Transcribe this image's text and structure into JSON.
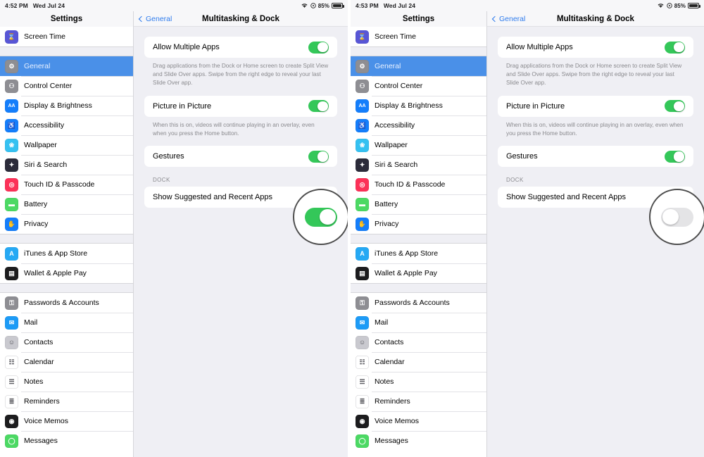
{
  "panels": [
    {
      "id": "left",
      "statusbar": {
        "time": "4:52 PM",
        "date": "Wed Jul 24",
        "battery_pct": "85%"
      },
      "sidebar_title": "Settings",
      "nav": {
        "back_label": "General",
        "title": "Multitasking & Dock"
      },
      "rows": [
        {
          "label": "Allow Multiple Apps",
          "state": "on"
        },
        {
          "label": "Picture in Picture",
          "state": "on"
        },
        {
          "label": "Gestures",
          "state": "on"
        },
        {
          "label": "Show Suggested and Recent Apps",
          "state": "on"
        }
      ],
      "hint_multiple": "Drag applications from the Dock or Home screen to create Split View and Slide Over apps. Swipe from the right edge to reveal your last Slide Over app.",
      "hint_pip": "When this is on, videos will continue playing in an overlay, even when you press the Home button.",
      "dock_header": "DOCK",
      "annotated_toggle_state": "on"
    },
    {
      "id": "right",
      "statusbar": {
        "time": "4:53 PM",
        "date": "Wed Jul 24",
        "battery_pct": "85%"
      },
      "sidebar_title": "Settings",
      "nav": {
        "back_label": "General",
        "title": "Multitasking & Dock"
      },
      "rows": [
        {
          "label": "Allow Multiple Apps",
          "state": "on"
        },
        {
          "label": "Picture in Picture",
          "state": "on"
        },
        {
          "label": "Gestures",
          "state": "on"
        },
        {
          "label": "Show Suggested and Recent Apps",
          "state": "off"
        }
      ],
      "hint_multiple": "Drag applications from the Dock or Home screen to create Split View and Slide Over apps. Swipe from the right edge to reveal your last Slide Over app.",
      "hint_pip": "When this is on, videos will continue playing in an overlay, even when you press the Home button.",
      "dock_header": "DOCK",
      "annotated_toggle_state": "off"
    }
  ],
  "sidebar_groups": [
    {
      "items": [
        {
          "label": "Screen Time",
          "icon": "hourglass-icon",
          "color": "#5856d6",
          "glyph": "⌛",
          "selected": false
        }
      ]
    },
    {
      "items": [
        {
          "label": "General",
          "icon": "gear-icon",
          "color": "#8e8e93",
          "glyph": "⚙",
          "selected": true
        },
        {
          "label": "Control Center",
          "icon": "control-center-icon",
          "color": "#8e8e93",
          "glyph": "⚇",
          "selected": false
        },
        {
          "label": "Display & Brightness",
          "icon": "display-brightness-icon",
          "color": "#147efb",
          "glyph": "AA",
          "selected": false
        },
        {
          "label": "Accessibility",
          "icon": "accessibility-icon",
          "color": "#147efb",
          "glyph": "♿",
          "selected": false
        },
        {
          "label": "Wallpaper",
          "icon": "wallpaper-icon",
          "color": "#35c1f1",
          "glyph": "❀",
          "selected": false
        },
        {
          "label": "Siri & Search",
          "icon": "siri-icon",
          "color": "#2b2b3a",
          "glyph": "✦",
          "selected": false
        },
        {
          "label": "Touch ID & Passcode",
          "icon": "touch-id-icon",
          "color": "#fc3158",
          "glyph": "◎",
          "selected": false
        },
        {
          "label": "Battery",
          "icon": "battery-icon",
          "color": "#4cd964",
          "glyph": "▬",
          "selected": false
        },
        {
          "label": "Privacy",
          "icon": "privacy-icon",
          "color": "#147efb",
          "glyph": "✋",
          "selected": false
        }
      ]
    },
    {
      "items": [
        {
          "label": "iTunes & App Store",
          "icon": "app-store-icon",
          "color": "#26a9f4",
          "glyph": "A",
          "selected": false
        },
        {
          "label": "Wallet & Apple Pay",
          "icon": "wallet-icon",
          "color": "#1c1c1e",
          "glyph": "▤",
          "selected": false
        }
      ]
    },
    {
      "items": [
        {
          "label": "Passwords & Accounts",
          "icon": "key-icon",
          "color": "#8e8e93",
          "glyph": "⚿",
          "selected": false
        },
        {
          "label": "Mail",
          "icon": "mail-icon",
          "color": "#1d9bf6",
          "glyph": "✉",
          "selected": false
        },
        {
          "label": "Contacts",
          "icon": "contacts-icon",
          "color": "#c9c9cf",
          "glyph": "☺",
          "selected": false
        },
        {
          "label": "Calendar",
          "icon": "calendar-icon",
          "color": "#ffffff",
          "glyph": "☷",
          "selected": false
        },
        {
          "label": "Notes",
          "icon": "notes-icon",
          "color": "#ffffff",
          "glyph": "☰",
          "selected": false
        },
        {
          "label": "Reminders",
          "icon": "reminders-icon",
          "color": "#ffffff",
          "glyph": "≣",
          "selected": false
        },
        {
          "label": "Voice Memos",
          "icon": "voice-memos-icon",
          "color": "#1c1c1e",
          "glyph": "◉",
          "selected": false
        },
        {
          "label": "Messages",
          "icon": "messages-icon",
          "color": "#4cd964",
          "glyph": "◯",
          "selected": false
        }
      ]
    }
  ],
  "icons": {
    "wifi": "wifi-icon",
    "rotation_lock": "rotation-lock-icon",
    "battery": "battery-icon"
  }
}
